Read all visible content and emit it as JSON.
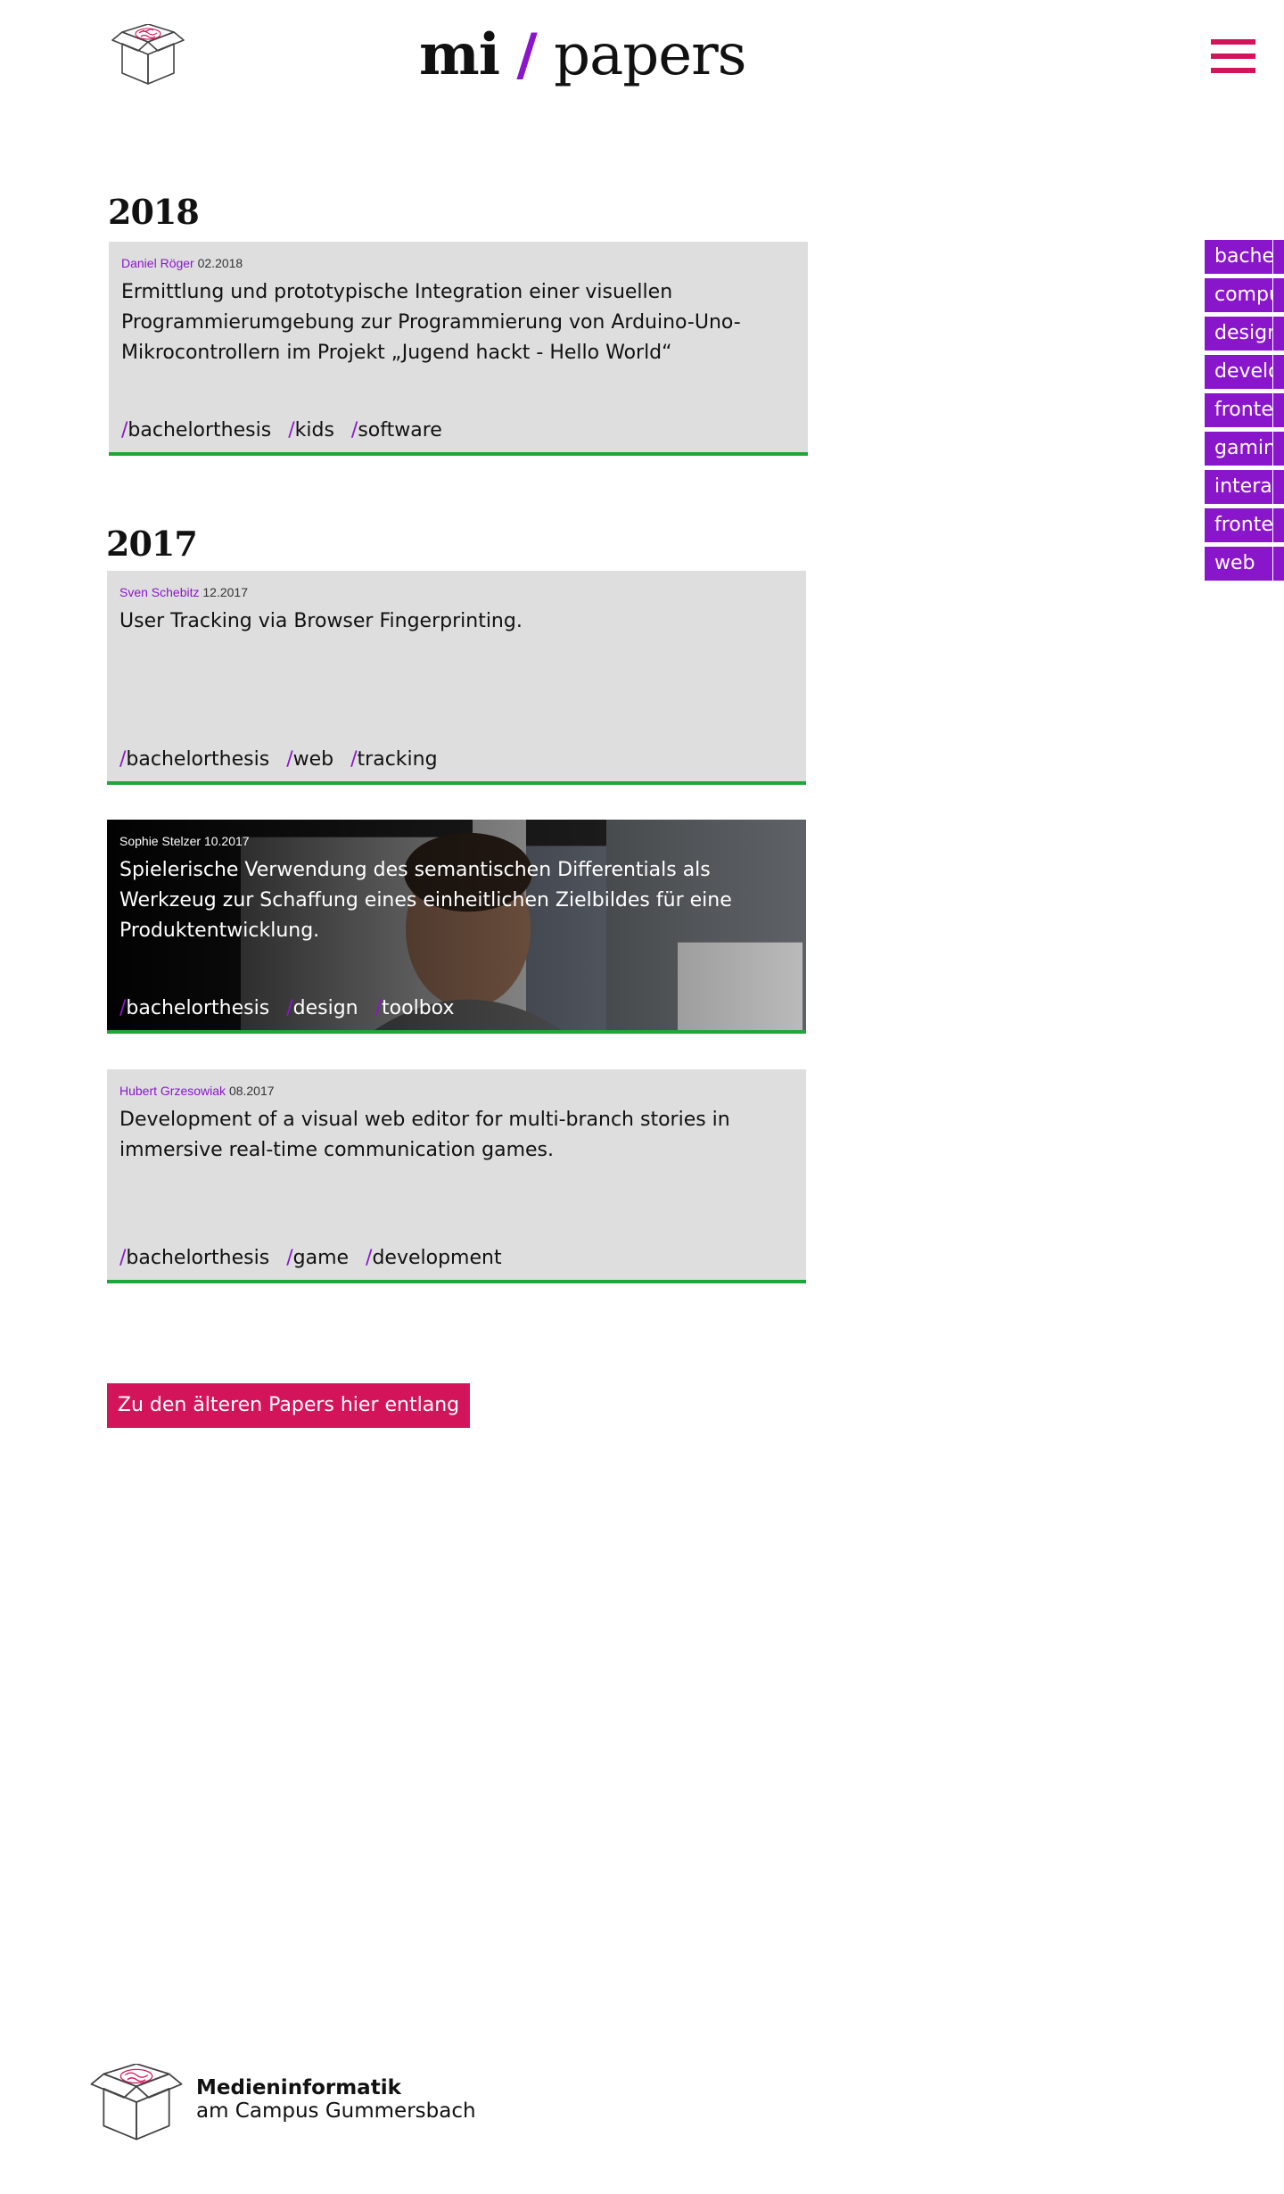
{
  "header": {
    "title_bold": "mi",
    "title_slash": "/",
    "title_rest": "papers"
  },
  "sections": [
    {
      "year": "2018",
      "papers": [
        {
          "author": "Daniel Röger",
          "date": "02.2018",
          "title": "Ermittlung und prototypische Integration einer visuellen Programmierumgebung zur Programmierung von Arduino-Uno-Mikrocontrollern im Projekt „Jugend hackt - Hello World“",
          "tags": [
            "bachelorthesis",
            "kids",
            "software"
          ]
        }
      ]
    },
    {
      "year": "2017",
      "papers": [
        {
          "author": "Sven Schebitz",
          "date": "12.2017",
          "title": "User Tracking via Browser Fingerprinting.",
          "tags": [
            "bachelorthesis",
            "web",
            "tracking"
          ]
        },
        {
          "author": "Sophie Stelzer",
          "date": "10.2017",
          "title": "Spielerische Verwendung des semantischen Differentials als Werkzeug zur Schaffung eines einheitlichen Zielbildes für eine Produktentwicklung.",
          "tags": [
            "bachelorthesis",
            "design",
            "toolbox"
          ],
          "has_image": true
        },
        {
          "author": "Hubert Grzesowiak",
          "date": "08.2017",
          "title": "Development of a visual web editor for multi-branch stories in immersive real-time communication games.",
          "tags": [
            "bachelorthesis",
            "game",
            "development"
          ]
        }
      ]
    }
  ],
  "side_tags": [
    "bachelorthesis",
    "computer",
    "design",
    "development",
    "frontend",
    "gaming",
    "interaction",
    "frontend",
    "web"
  ],
  "older_button": "Zu den älteren Papers hier entlang",
  "footer": {
    "line1": "Medieninformatik",
    "line2": "am Campus Gummersbach"
  },
  "colors": {
    "accent_purple": "#8a16cc",
    "accent_pink": "#d4145a",
    "card_bg": "#dedede",
    "card_border": "#1fa63a"
  },
  "icons": {
    "logo": "box-with-brain-icon",
    "menu": "hamburger-menu-icon"
  }
}
